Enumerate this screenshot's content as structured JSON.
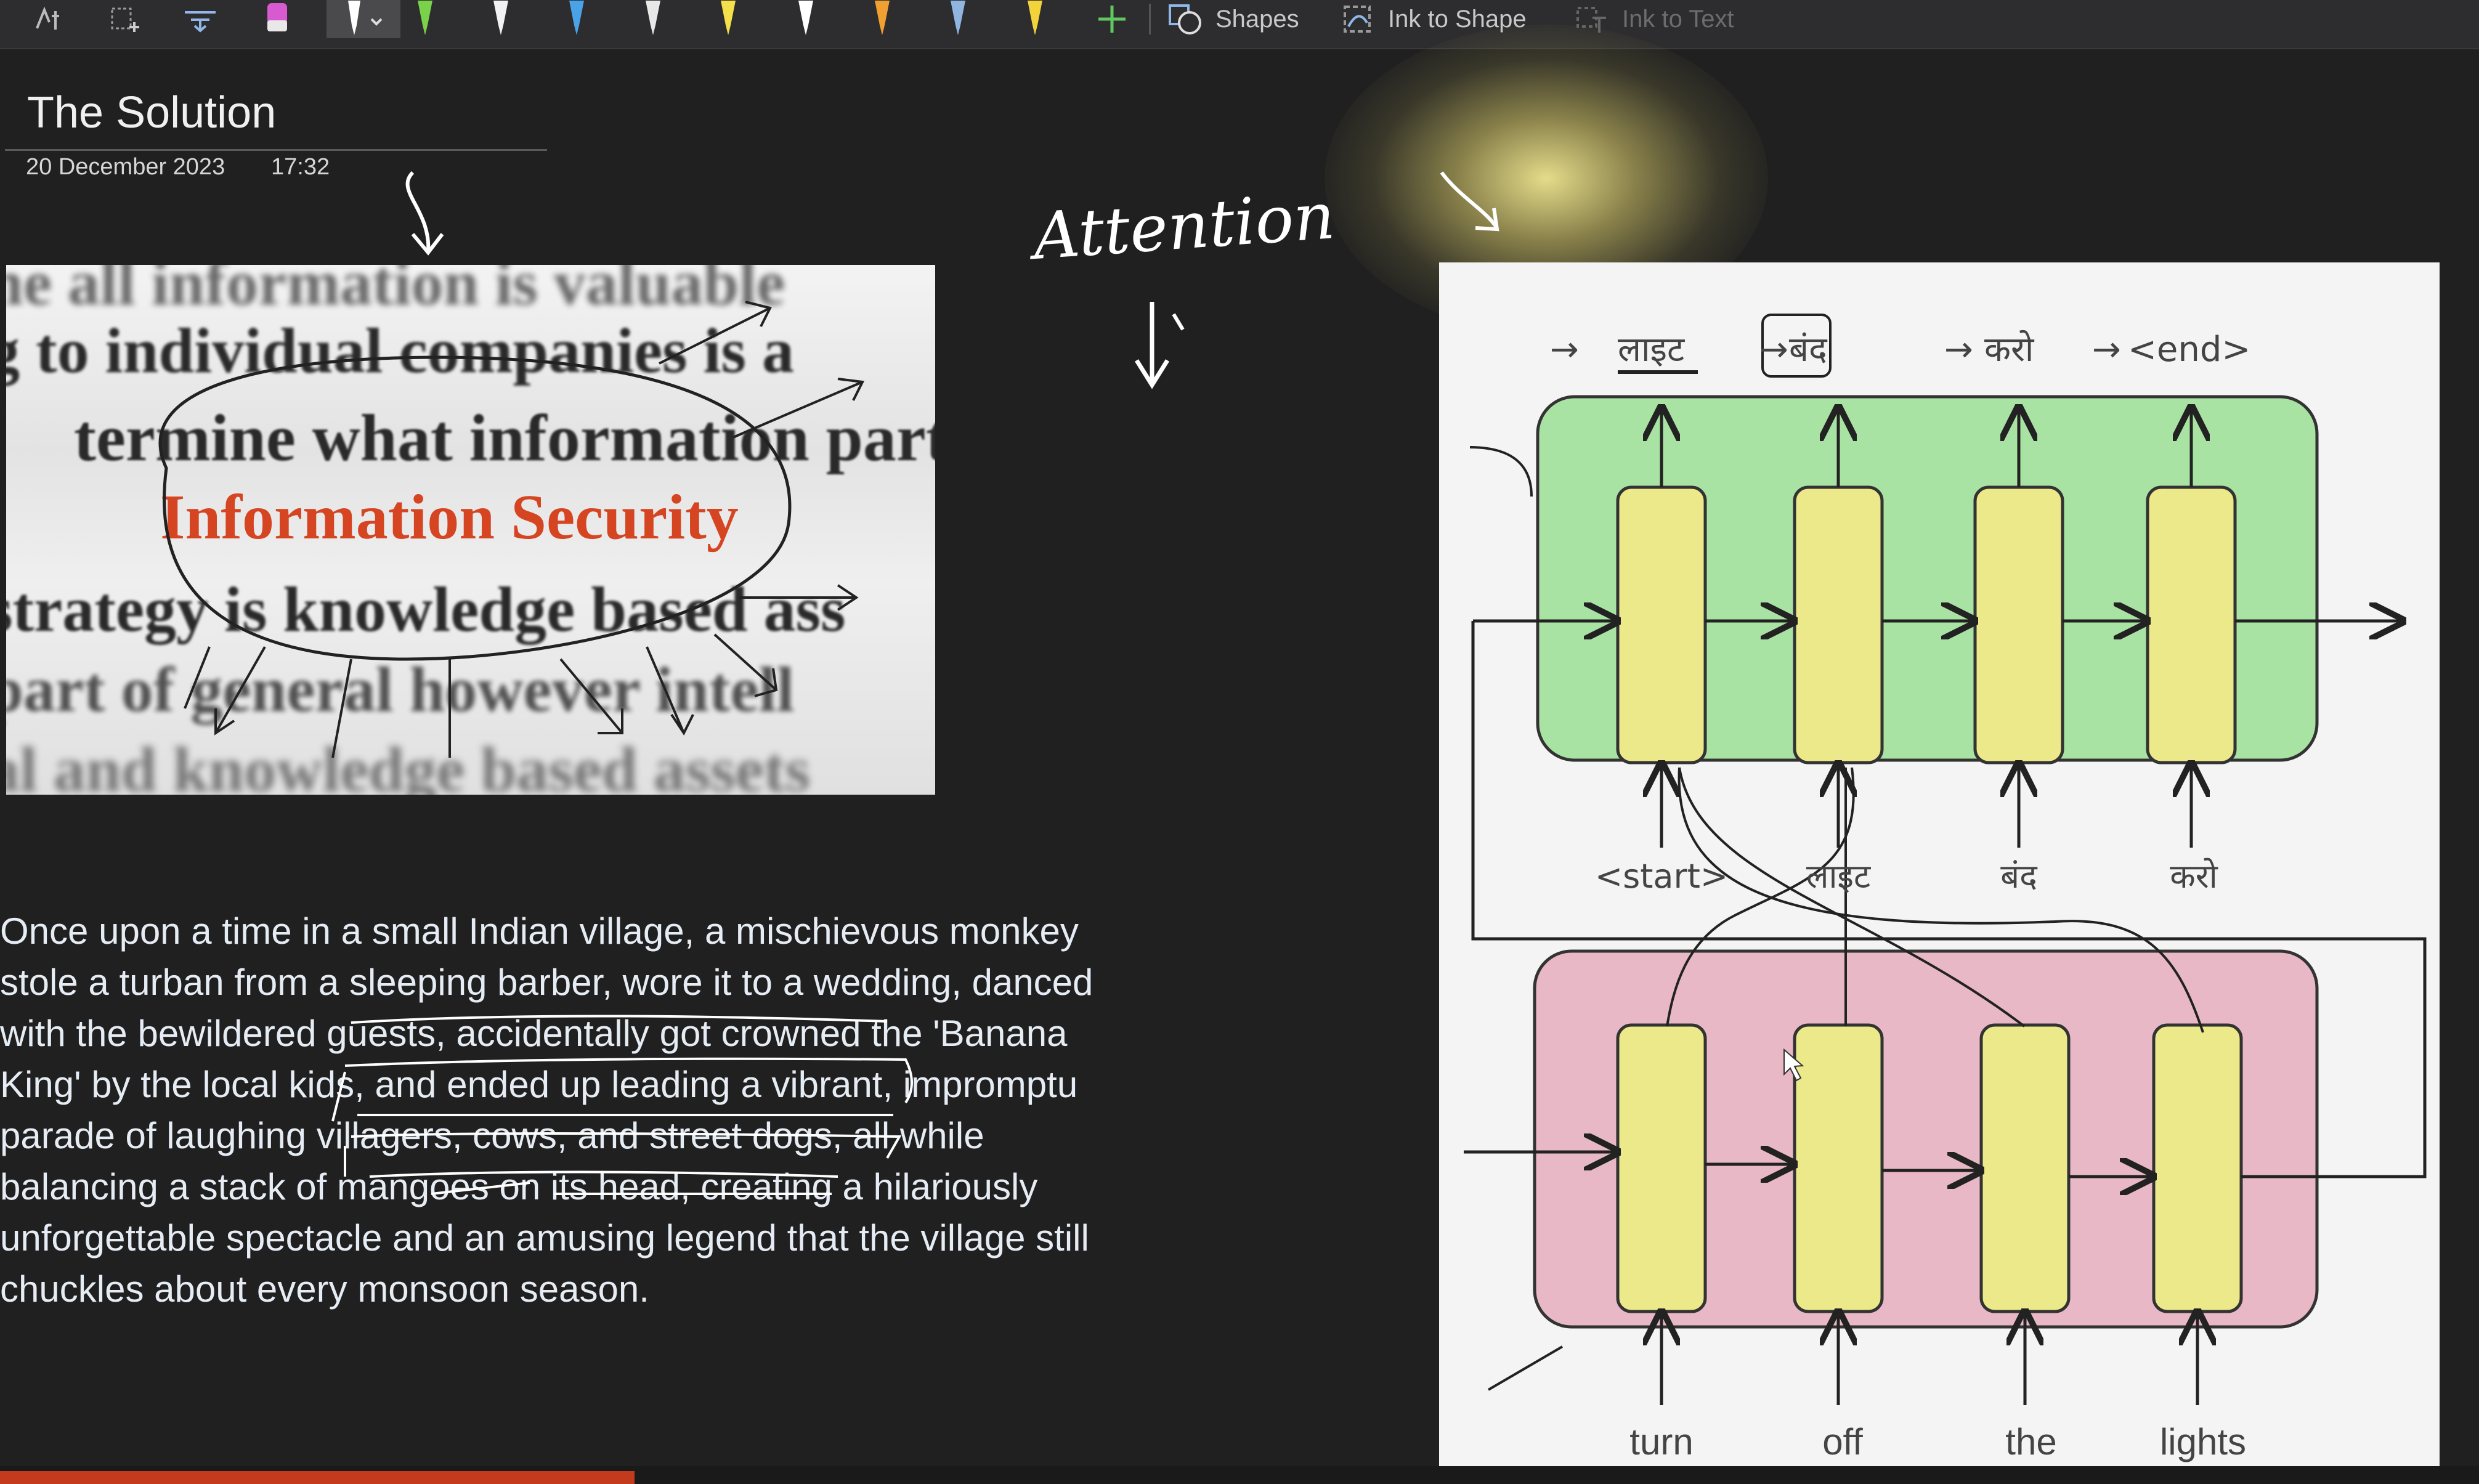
{
  "toolbar": {
    "shapes_label": "Shapes",
    "ink_to_shape_label": "Ink to Shape",
    "ink_to_text_label": "Ink to Text",
    "pens": [
      {
        "icon": "pen-icon",
        "color": "#ffffff"
      },
      {
        "icon": "pen-icon",
        "color": "#7ad14a"
      },
      {
        "icon": "pen-icon",
        "color": "#f2f2f2"
      },
      {
        "icon": "pen-icon",
        "color": "#4aa3e8"
      },
      {
        "icon": "pen-icon",
        "color": "#e8e8e8"
      },
      {
        "icon": "pen-icon",
        "color": "#f4e04a"
      },
      {
        "icon": "pen-icon",
        "color": "#ffffff"
      },
      {
        "icon": "pen-icon",
        "color": "#f0a030"
      },
      {
        "icon": "pen-icon",
        "color": "#8fb5e0"
      },
      {
        "icon": "pen-icon",
        "color": "#f2d33a"
      }
    ]
  },
  "page": {
    "title": "The Solution",
    "date": "20 December 2023",
    "time": "17:32"
  },
  "image": {
    "highlight": "Information Security",
    "lines": [
      "ne all information is valuable",
      "g to individual companies is a",
      "termine what information part",
      "strategy is knowledge based ass",
      "part of general however intell",
      "al and knowledge based assets"
    ]
  },
  "ink": {
    "attention_note": "Attention"
  },
  "story": {
    "lines": [
      "Once upon a time in a small Indian village, a mischievous monkey",
      "stole a turban from a sleeping barber, wore it to a wedding, danced",
      "with the bewildered guests, accidentally got crowned the 'Banana",
      "King' by the local kids, and ended up leading a vibrant, impromptu",
      "parade of laughing villagers, cows, and street dogs, all while",
      "balancing a stack of mangoes on its head, creating a hilariously",
      "unforgettable spectacle and an amusing legend that the village still",
      "chuckles about every monsoon season."
    ]
  },
  "diagram": {
    "decoder_outputs": [
      "लाइट",
      "बंद",
      "करो",
      "<end>"
    ],
    "decoder_inputs": [
      "<start>",
      "लाइट",
      "बंद",
      "करो"
    ],
    "encoder_inputs": [
      "turn",
      "off",
      "the",
      "lights"
    ],
    "colors": {
      "decoder_box": "#a9e3a3",
      "encoder_box": "#e9b8c6",
      "cell": "#ece98a",
      "panel": "#f4f4f4"
    }
  }
}
